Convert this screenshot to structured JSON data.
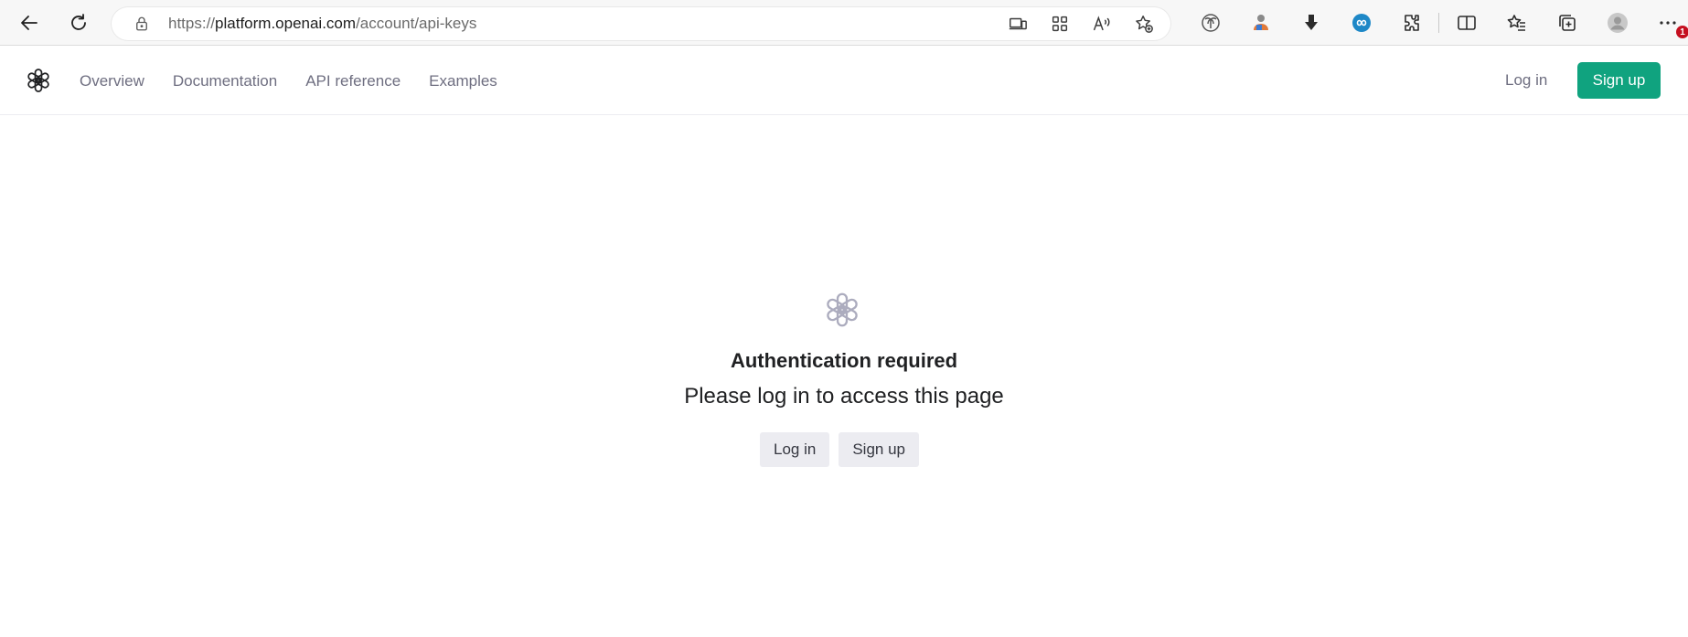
{
  "browser": {
    "url_scheme": "https://",
    "url_host": "platform.openai.com",
    "url_path": "/account/api-keys",
    "extensions_badge": "1"
  },
  "header": {
    "nav": [
      {
        "label": "Overview"
      },
      {
        "label": "Documentation"
      },
      {
        "label": "API reference"
      },
      {
        "label": "Examples"
      }
    ],
    "login_label": "Log in",
    "signup_label": "Sign up"
  },
  "auth": {
    "title": "Authentication required",
    "subtitle": "Please log in to access this page",
    "login_label": "Log in",
    "signup_label": "Sign up"
  },
  "colors": {
    "brand_green": "#10a37f",
    "nav_text": "#6e6e80",
    "button_gray": "#ececf1",
    "logo_gray": "#acacbe"
  },
  "icons": {
    "back": "arrow-left-icon",
    "reload": "reload-icon",
    "lock": "lock-icon",
    "site_logo": "openai-logo-icon"
  }
}
